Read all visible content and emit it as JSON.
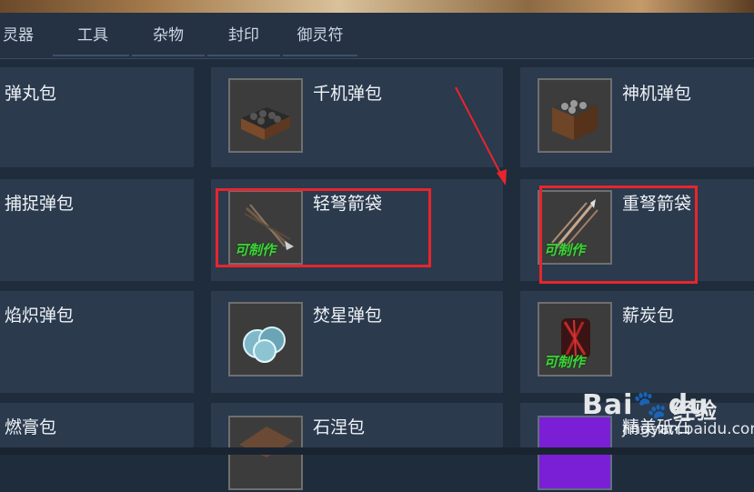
{
  "tabs": [
    {
      "label": "灵器"
    },
    {
      "label": "工具"
    },
    {
      "label": "杂物"
    },
    {
      "label": "封印"
    },
    {
      "label": "御灵符"
    }
  ],
  "craftable_label": "可制作",
  "items": [
    {
      "name": "弹丸包"
    },
    {
      "name": "千机弹包",
      "icon": "crate-of-pellets-icon"
    },
    {
      "name": "神机弹包",
      "icon": "crate-of-pellets-icon"
    },
    {
      "name": "捕捉弹包"
    },
    {
      "name": "轻弩箭袋",
      "icon": "bolt-quiver-icon",
      "craftable": true
    },
    {
      "name": "重弩箭袋",
      "icon": "bolt-quiver-icon",
      "craftable": true
    },
    {
      "name": "焰炽弹包"
    },
    {
      "name": "焚星弹包",
      "icon": "glowing-orbs-icon"
    },
    {
      "name": "薪炭包",
      "icon": "red-charcoal-icon",
      "craftable": true
    },
    {
      "name": "燃膏包"
    },
    {
      "name": "石涅包",
      "icon": "stone-pack-icon"
    },
    {
      "name": "精美砥石",
      "icon": "whetstone-icon"
    }
  ],
  "watermark": {
    "brand": "Bai",
    "paw": "du",
    "jingyan": "经验",
    "url": "jingyan.baidu.com"
  },
  "colors": {
    "background": "#1f2c3b",
    "cell": "#2b3a4d",
    "highlight_box": "#e8252d",
    "craftable_text": "#3fd23a"
  }
}
